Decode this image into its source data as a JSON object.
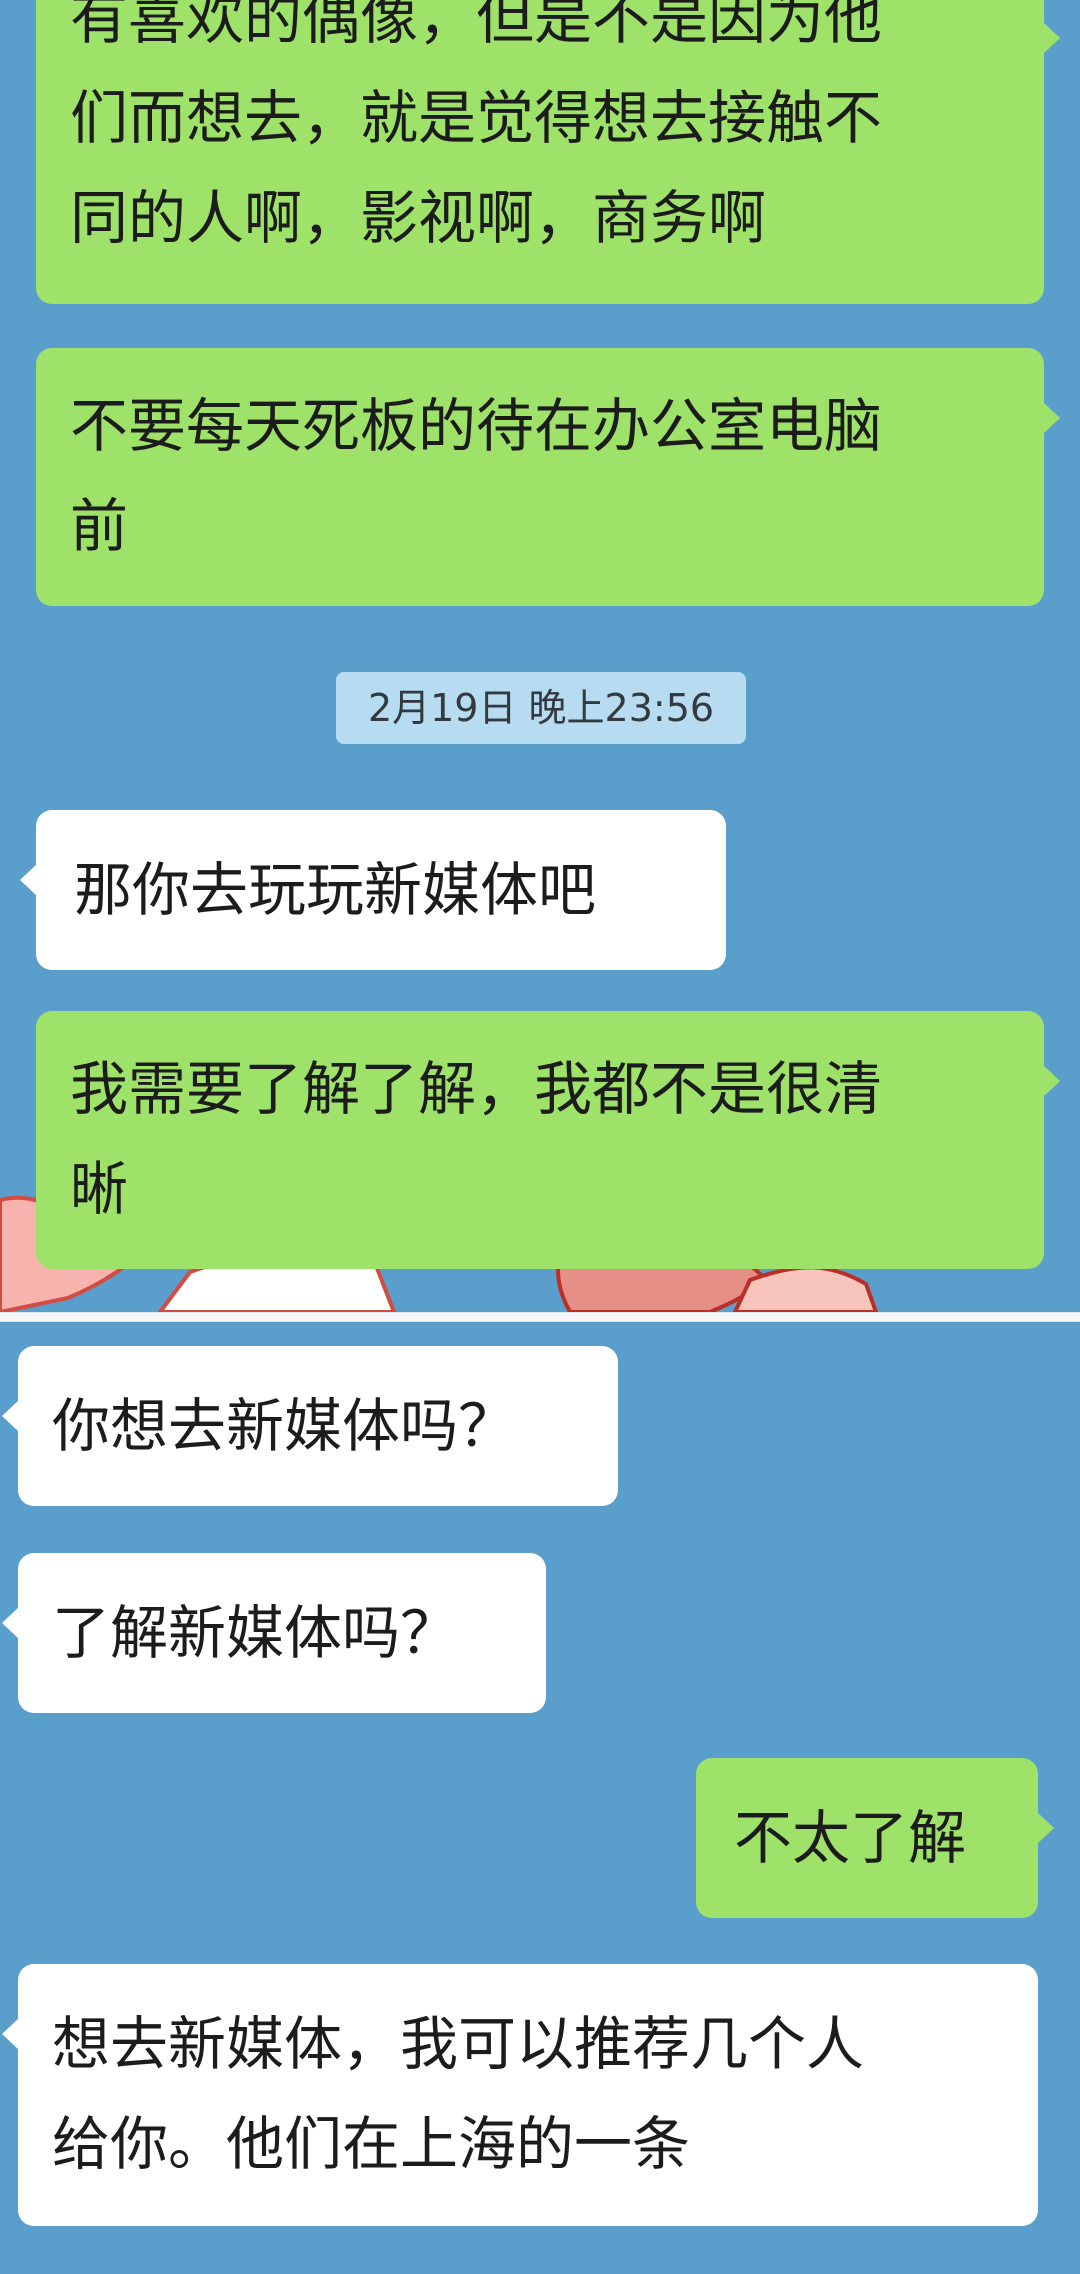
{
  "chat": {
    "top_panel": {
      "messages": [
        {
          "side": "outgoing",
          "text": "有喜欢的偶像，但是不是因为他\n们而想去，就是觉得想去接触不\n同的人啊，影视啊，商务啊"
        },
        {
          "side": "outgoing",
          "text": "不要每天死板的待在办公室电脑\n前"
        },
        {
          "side": "incoming",
          "text": "那你去玩玩新媒体吧"
        },
        {
          "side": "outgoing",
          "text": "我需要了解了解，我都不是很清\n晰"
        }
      ],
      "timestamp": "2月19日 晚上23:56"
    },
    "bottom_panel": {
      "messages": [
        {
          "side": "incoming",
          "text": "你想去新媒体吗？"
        },
        {
          "side": "incoming",
          "text": "了解新媒体吗？"
        },
        {
          "side": "outgoing",
          "text": "不太了解"
        },
        {
          "side": "incoming",
          "text": "想去新媒体，我可以推荐几个人\n给你。他们在上海的一条"
        }
      ]
    }
  },
  "colors": {
    "chat_background": "#5a9ecb",
    "outgoing_bubble": "#9fe26a",
    "incoming_bubble": "#ffffff",
    "timestamp_background": "#b7dcf1"
  }
}
